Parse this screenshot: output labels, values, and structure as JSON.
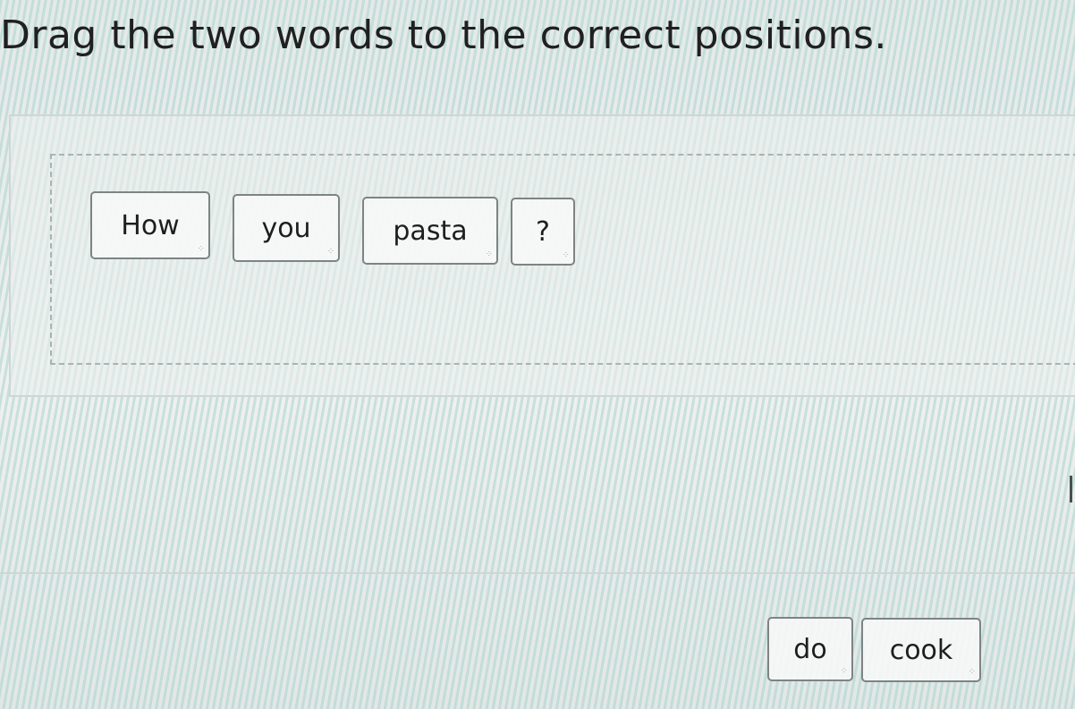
{
  "instruction": "Drag the two words to the correct positions.",
  "sentence_tiles": [
    {
      "label": "How"
    },
    {
      "label": "you"
    },
    {
      "label": "pasta"
    },
    {
      "label": "?"
    }
  ],
  "word_bank": [
    {
      "label": "do"
    },
    {
      "label": "cook"
    }
  ],
  "icons": {
    "drag_handle": "drag-handle-dots-icon"
  },
  "colors": {
    "tile_border": "#7d8483",
    "dashed_zone_border": "#a9b3b2",
    "background_stripes": "#a8d4cc"
  }
}
